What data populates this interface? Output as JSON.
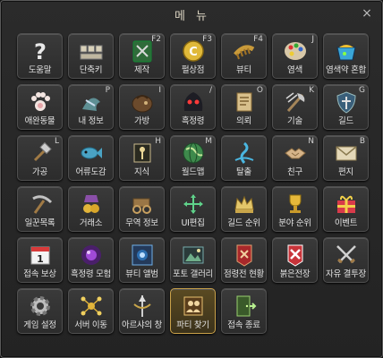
{
  "window": {
    "title": "메 뉴",
    "close_glyph": "×"
  },
  "items": [
    {
      "label": "도움말",
      "key": "",
      "icon": "question-icon"
    },
    {
      "label": "단축키",
      "key": "",
      "icon": "keyboard-icon"
    },
    {
      "label": "제작",
      "key": "F2",
      "icon": "craft-book-icon"
    },
    {
      "label": "펄상점",
      "key": "F3",
      "icon": "pearl-coin-icon"
    },
    {
      "label": "뷰티",
      "key": "F4",
      "icon": "comb-icon"
    },
    {
      "label": "염색",
      "key": "J",
      "icon": "palette-icon"
    },
    {
      "label": "염색약 혼합",
      "key": "",
      "icon": "dye-mix-icon"
    },
    {
      "label": "애완동물",
      "key": "",
      "icon": "paw-icon"
    },
    {
      "label": "내 정보",
      "key": "P",
      "icon": "character-icon"
    },
    {
      "label": "가방",
      "key": "I",
      "icon": "bag-icon"
    },
    {
      "label": "흑정령",
      "key": "/",
      "icon": "black-spirit-icon"
    },
    {
      "label": "의뢰",
      "key": "O",
      "icon": "quest-scroll-icon"
    },
    {
      "label": "기술",
      "key": "K",
      "icon": "skill-axe-icon"
    },
    {
      "label": "길드",
      "key": "G",
      "icon": "guild-shield-icon"
    },
    {
      "label": "가공",
      "key": "L",
      "icon": "hammer-icon"
    },
    {
      "label": "어류도감",
      "key": "",
      "icon": "fish-icon"
    },
    {
      "label": "지식",
      "key": "H",
      "icon": "knowledge-icon"
    },
    {
      "label": "월드맵",
      "key": "M",
      "icon": "globe-icon"
    },
    {
      "label": "탈출",
      "key": "",
      "icon": "escape-icon"
    },
    {
      "label": "친구",
      "key": "N",
      "icon": "handshake-icon"
    },
    {
      "label": "편지",
      "key": "B",
      "icon": "mail-icon"
    },
    {
      "label": "일꾼목록",
      "key": "",
      "icon": "pickaxe-icon"
    },
    {
      "label": "거래소",
      "key": "",
      "icon": "market-icon"
    },
    {
      "label": "무역 정보",
      "key": "",
      "icon": "wagon-icon"
    },
    {
      "label": "UI편집",
      "key": "",
      "icon": "move-arrows-icon"
    },
    {
      "label": "길드 순위",
      "key": "",
      "icon": "crown-icon"
    },
    {
      "label": "분야 순위",
      "key": "",
      "icon": "trophy-icon"
    },
    {
      "label": "이벤트",
      "key": "",
      "icon": "gift-icon"
    },
    {
      "label": "접속 보상",
      "key": "",
      "icon": "calendar-icon"
    },
    {
      "label": "흑정령 모험",
      "key": "",
      "icon": "dark-orb-icon"
    },
    {
      "label": "뷰티 앨범",
      "key": "",
      "icon": "album-icon"
    },
    {
      "label": "포토 갤러리",
      "key": "",
      "icon": "photo-icon"
    },
    {
      "label": "점령전 현황",
      "key": "",
      "icon": "siege-banner-icon"
    },
    {
      "label": "붉은전장",
      "key": "",
      "icon": "red-battlefield-icon"
    },
    {
      "label": "자유 결투장",
      "key": "",
      "icon": "crossed-swords-icon"
    },
    {
      "label": "게임 설정",
      "key": "",
      "icon": "gear-icon"
    },
    {
      "label": "서버 이동",
      "key": "",
      "icon": "server-nodes-icon"
    },
    {
      "label": "아르샤의 창",
      "key": "",
      "icon": "arsha-spear-icon"
    },
    {
      "label": "파티 찾기",
      "key": "",
      "icon": "party-search-icon",
      "selected": true
    },
    {
      "label": "접속 종료",
      "key": "",
      "icon": "exit-door-icon"
    }
  ]
}
